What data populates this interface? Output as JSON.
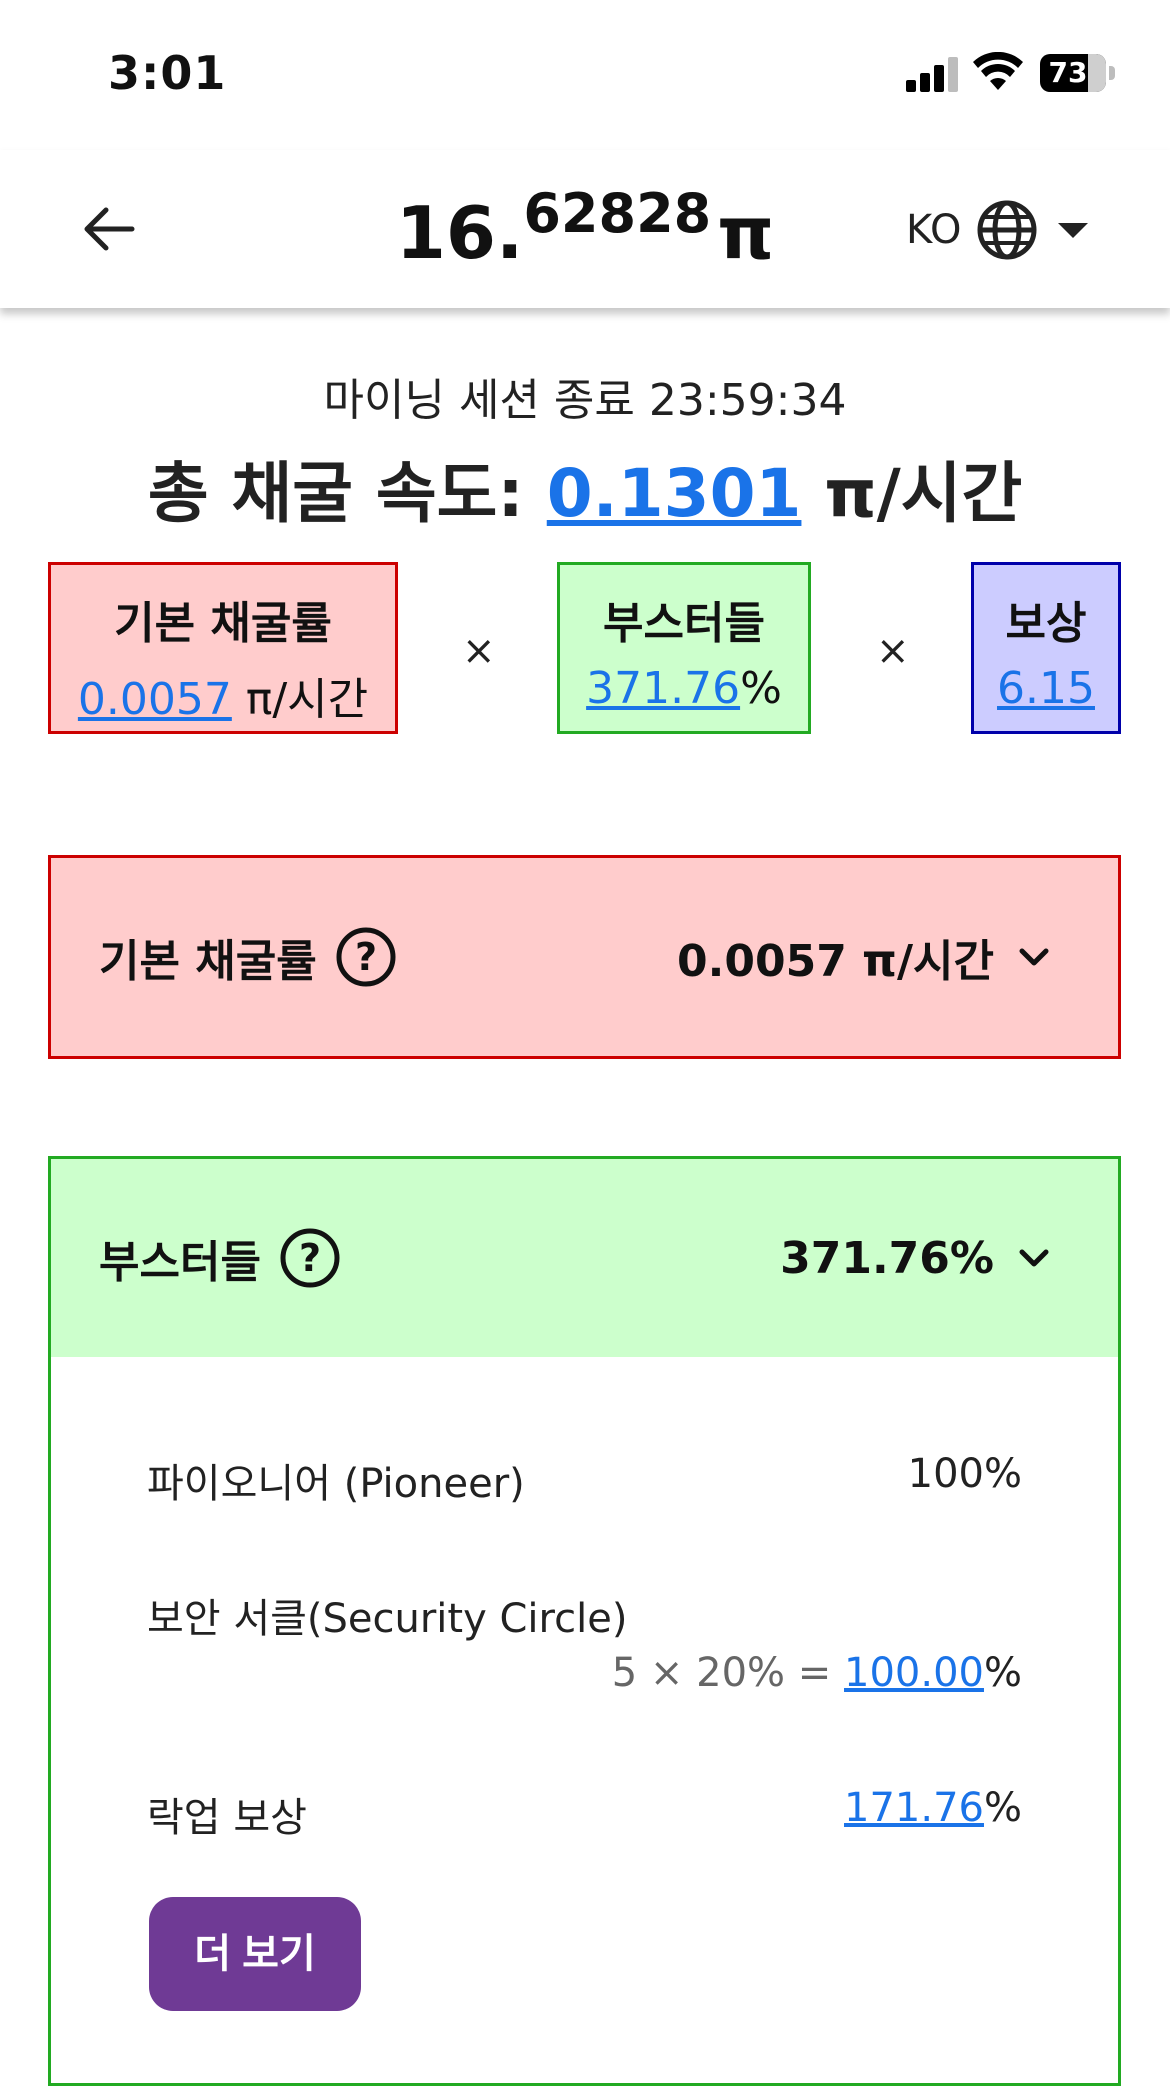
{
  "status_bar": {
    "time": "3:01",
    "battery": "73",
    "icons": [
      "signal-icon",
      "wifi-icon",
      "battery-icon"
    ]
  },
  "header": {
    "balance_int": "16.",
    "balance_frac": "62828",
    "balance_unit": "π",
    "lang": "KO",
    "icons": [
      "back-arrow-icon",
      "globe-icon",
      "caret-down-icon"
    ]
  },
  "session": {
    "label": "마이닝 세션 종료",
    "countdown": "23:59:34"
  },
  "total_rate": {
    "label": "총 채굴 속도:",
    "value": "0.1301",
    "unit": "π/시간"
  },
  "formula": {
    "base_title": "기본 채굴률",
    "base_value": "0.0057",
    "base_unit": "π/시간",
    "boosters_title": "부스터들",
    "boosters_value": "371.76",
    "boosters_unit": "%",
    "reward_title": "보상",
    "reward_value": "6.15",
    "times": "×"
  },
  "base_section": {
    "title": "기본 채굴률",
    "value": "0.0057 π/시간"
  },
  "boosters_section": {
    "title": "부스터들",
    "value": "371.76%",
    "items": [
      {
        "name": "파이오니어 (Pioneer)",
        "value": "100%"
      },
      {
        "name": "보안 서클(Security Circle)",
        "calc": "5 × 20% = ",
        "value": "100.00",
        "unit": "%"
      },
      {
        "name": "락업 보상",
        "value": "171.76",
        "unit": "%"
      }
    ],
    "more_label": "더 보기"
  },
  "colors": {
    "red_bg": "#ffcccc",
    "red_border": "#cc0000",
    "green_bg": "#ccffcc",
    "green_border": "#22aa22",
    "blue_bg": "#ccccff",
    "blue_border": "#0000aa",
    "link": "#1a73e8",
    "button": "#6f3a95"
  }
}
